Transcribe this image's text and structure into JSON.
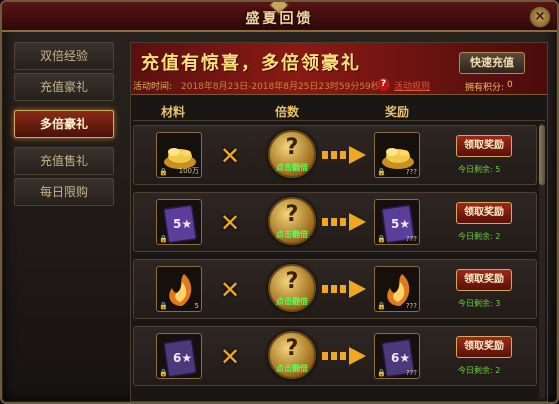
{
  "window": {
    "title": "盛夏回馈",
    "close_glyph": "×"
  },
  "sidebar": {
    "items": [
      {
        "label": "双倍经验",
        "active": false
      },
      {
        "label": "充值豪礼",
        "active": false
      },
      {
        "label": "多倍豪礼",
        "active": true
      },
      {
        "label": "充值售礼",
        "active": false
      },
      {
        "label": "每日限购",
        "active": false
      }
    ]
  },
  "banner": {
    "title": "充值有惊喜，多倍领豪礼",
    "time_label": "活动时间:",
    "time_value": "2018年8月23日-2018年8月25日23时59分59秒",
    "rules_label": "活动规则",
    "recharge_label": "快速充值",
    "points_label": "拥有积分:",
    "points_value": "0"
  },
  "columns": {
    "material": "材料",
    "multiplier": "倍数",
    "reward": "奖励"
  },
  "rows": [
    {
      "item_icon": "gold-ingot-icon",
      "material_qty": "100万",
      "mystery_label": "?",
      "flip_label": "点击翻倍",
      "reward_qty": "???",
      "claim_label": "领取奖励",
      "remain_label": "今日剩余:",
      "remain_value": "5"
    },
    {
      "item_icon": "five-star-card-icon",
      "material_qty": "",
      "mystery_label": "?",
      "flip_label": "点击翻倍",
      "reward_qty": "???",
      "claim_label": "领取奖励",
      "remain_label": "今日剩余:",
      "remain_value": "2"
    },
    {
      "item_icon": "flame-shard-icon",
      "material_qty": "5",
      "mystery_label": "?",
      "flip_label": "点击翻倍",
      "reward_qty": "???",
      "claim_label": "领取奖励",
      "remain_label": "今日剩余:",
      "remain_value": "3"
    },
    {
      "item_icon": "six-star-card-icon",
      "material_qty": "",
      "mystery_label": "?",
      "flip_label": "点击翻倍",
      "reward_qty": "???",
      "claim_label": "领取奖励",
      "remain_label": "今日剩余:",
      "remain_value": "2"
    }
  ],
  "colors": {
    "accent_gold": "#f0a820",
    "remain_green": "#6ad03a",
    "banner_red": "#8a1a14"
  }
}
